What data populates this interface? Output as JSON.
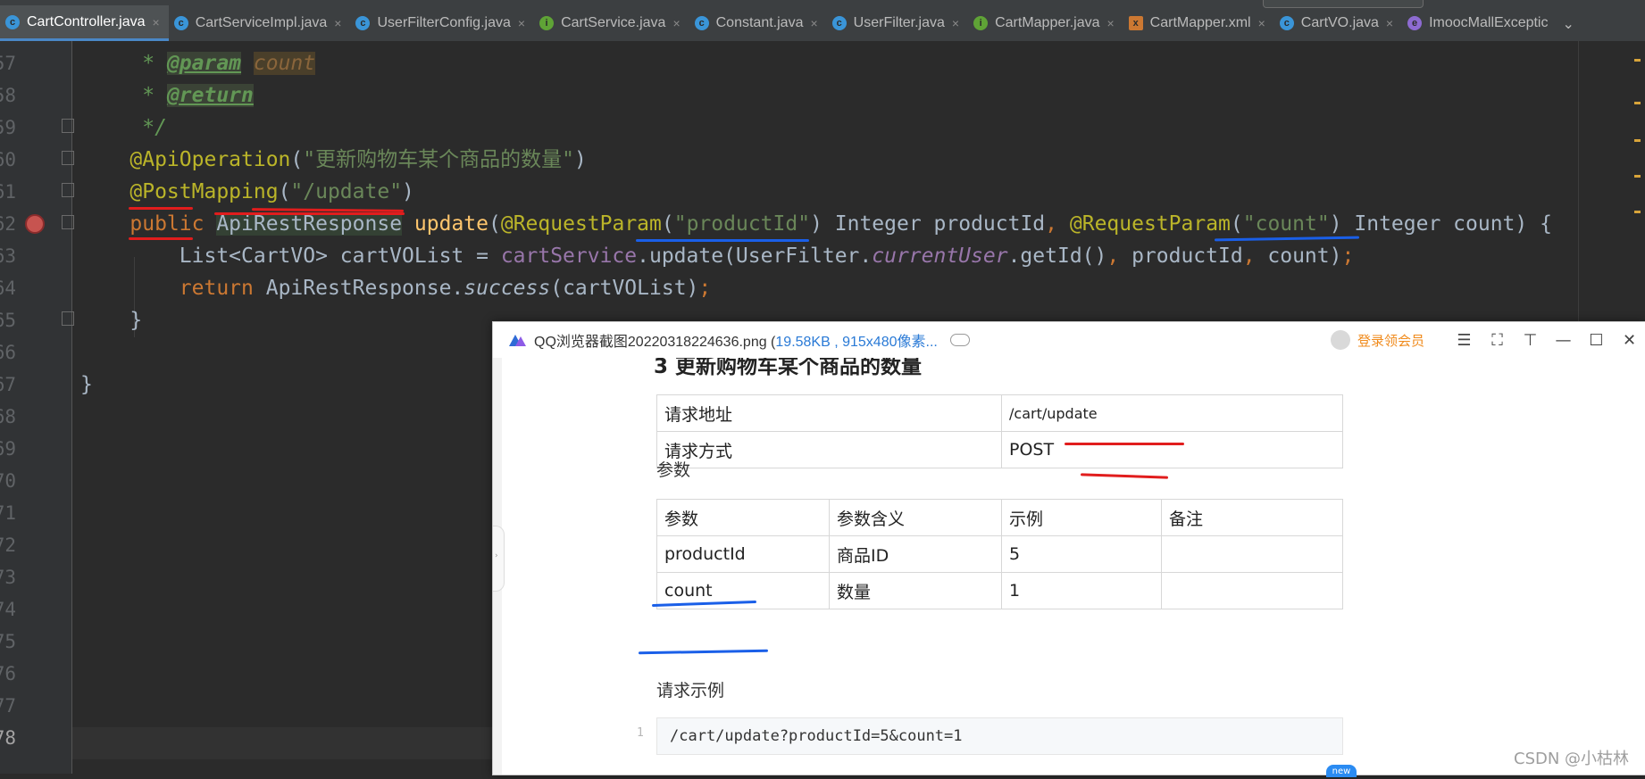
{
  "tabs": [
    {
      "label": "CartController.java",
      "icon": "class-icon",
      "active": true
    },
    {
      "label": "CartServiceImpl.java",
      "icon": "class-icon"
    },
    {
      "label": "UserFilterConfig.java",
      "icon": "class-icon"
    },
    {
      "label": "CartService.java",
      "icon": "interface-icon"
    },
    {
      "label": "Constant.java",
      "icon": "class-icon"
    },
    {
      "label": "UserFilter.java",
      "icon": "class-icon"
    },
    {
      "label": "CartMapper.java",
      "icon": "interface-icon"
    },
    {
      "label": "CartMapper.xml",
      "icon": "xml-icon"
    },
    {
      "label": "CartVO.java",
      "icon": "class-icon"
    },
    {
      "label": "ImoocMallExceptic",
      "icon": "enum-icon"
    }
  ],
  "tab_close_glyph": "×",
  "tab_overflow_glyph": "⌄",
  "gutter": {
    "line_numbers": [
      "57",
      "58",
      "59",
      "60",
      "61",
      "62",
      "63",
      "64",
      "65",
      "66",
      "67",
      "68",
      "69",
      "70",
      "71",
      "72",
      "73",
      "74",
      "75",
      "76",
      "77",
      "78"
    ],
    "current_line": "78"
  },
  "code": {
    "l57": {
      "star": "     * ",
      "tag": "@param",
      "sp": " ",
      "val": "count"
    },
    "l58": {
      "star": "     * ",
      "tag": "@return"
    },
    "l59": {
      "text": "     */"
    },
    "l60": {
      "ann": "    @ApiOperation",
      "p1": "(",
      "str": "\"更新购物车某个商品的数量\"",
      "p2": ")"
    },
    "l61": {
      "ann": "    @PostMapping",
      "p1": "(",
      "str": "\"/update\"",
      "p2": ")"
    },
    "l62": {
      "kw": "    public ",
      "type": "ApiRestResponse",
      "sp": " ",
      "fn": "update",
      "p1": "(",
      "ann1": "@RequestParam",
      "p2": "(",
      "str1": "\"productId\"",
      "p3": ") Integer productId",
      "comma": ", ",
      "ann2": "@RequestParam",
      "p4": "(",
      "str2": "\"count\"",
      "p5": ") Integer count) {"
    },
    "l63": {
      "a": "        List<CartVO> cartVOList = ",
      "fld": "cartService",
      "b": ".update(UserFilter.",
      "ifld": "currentUser",
      "c": ".getId()",
      "comma1": ", ",
      "d": "productId",
      "comma2": ", ",
      "e": "count)",
      "semi": ";"
    },
    "l64": {
      "kw": "        return ",
      "a": "ApiRestResponse.",
      "it": "success",
      "b": "(cartVOList)",
      "semi": ";"
    },
    "l65": {
      "text": "    }"
    },
    "l67": {
      "text": "}"
    }
  },
  "viewer": {
    "title_main": "QQ浏览器截图20220318224636.png (",
    "title_info": "19.58KB , 915x480像素...",
    "user_label": "登录领会员",
    "buttons": {
      "menu": "☰",
      "fullscreen": "⛶",
      "pin": "⊤",
      "minimize": "—",
      "maximize": "☐",
      "close": "✕"
    },
    "edge_arrow": "›",
    "doc": {
      "heading": "3    更新购物车某个商品的数量",
      "info_rows": [
        {
          "label": "请求地址",
          "value": "/cart/update"
        },
        {
          "label": "请求方式",
          "value": "POST"
        }
      ],
      "params_title": "参数",
      "params_headers": [
        "参数",
        "参数含义",
        "示例",
        "备注"
      ],
      "params_rows": [
        [
          "productId",
          "商品ID",
          "5",
          ""
        ],
        [
          "count",
          "数量",
          "1",
          ""
        ]
      ],
      "example_title": "请求示例",
      "example_line_no": "1",
      "example_code": "/cart/update?productId=5&count=1"
    },
    "badge": "new"
  },
  "watermark": "CSDN @小枯林",
  "colors": {
    "annotation": "#bbb529",
    "string": "#6a8759",
    "keyword": "#cc7832",
    "field": "#9876aa",
    "method": "#ffc66d",
    "ink_red": "#e11d1d",
    "ink_blue": "#1a5fe8"
  }
}
